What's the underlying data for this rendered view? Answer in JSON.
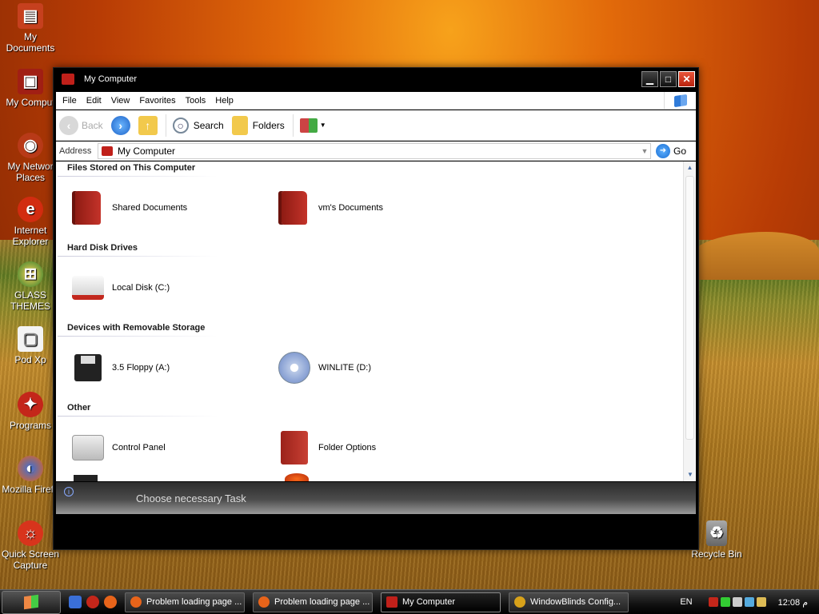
{
  "desktop": {
    "icons": [
      {
        "label": "My Documents",
        "icon": "folder-docs-icon"
      },
      {
        "label": "My Comput",
        "icon": "computer-icon"
      },
      {
        "label": "My Networ Places",
        "icon": "network-icon"
      },
      {
        "label": "Internet Explorer",
        "icon": "ie-icon"
      },
      {
        "label": "GLASS THEMES",
        "icon": "windows-orb-icon"
      },
      {
        "label": "Pod Xp",
        "icon": "document-icon"
      },
      {
        "label": "Programs",
        "icon": "programs-icon"
      },
      {
        "label": "Mozilla Firefo",
        "icon": "firefox-icon"
      },
      {
        "label": "Quick Screen Capture",
        "icon": "capture-icon"
      },
      {
        "label": "Recycle Bin",
        "icon": "recycle-bin-icon"
      }
    ]
  },
  "window": {
    "title": "My Computer",
    "menu": [
      "File",
      "Edit",
      "View",
      "Favorites",
      "Tools",
      "Help"
    ],
    "toolbar": {
      "back": "Back",
      "search": "Search",
      "folders": "Folders"
    },
    "address": {
      "label": "Address",
      "value": "My Computer",
      "go": "Go"
    },
    "groups": {
      "files": {
        "title": "Files Stored on This Computer",
        "items": [
          "Shared Documents",
          "vm's Documents"
        ]
      },
      "drives": {
        "title": "Hard Disk Drives",
        "items": [
          "Local Disk (C:)"
        ]
      },
      "removable": {
        "title": "Devices with Removable Storage",
        "items": [
          "3.5 Floppy (A:)",
          "WINLITE (D:)"
        ]
      },
      "other": {
        "title": "Other",
        "items": [
          "Control Panel",
          "Folder Options"
        ]
      }
    },
    "taskpane": {
      "text": "Choose necessary Task"
    }
  },
  "taskbar": {
    "tasks": [
      "Problem loading page ...",
      "Problem loading page ...",
      "My Computer",
      "WindowBlinds Config..."
    ],
    "lang": "EN",
    "clock": "12:08 م"
  },
  "colors": {
    "accent_red": "#c0201a",
    "taskbar_bg": "#111111"
  }
}
